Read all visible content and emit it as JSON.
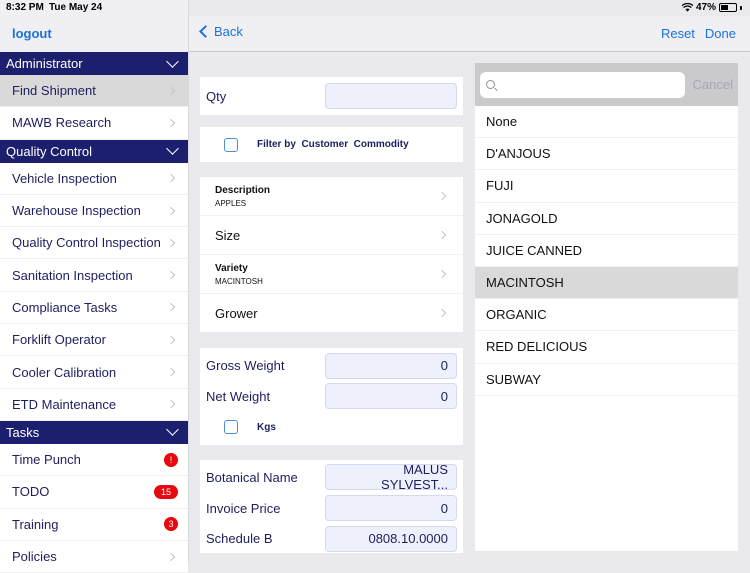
{
  "status_bar": {
    "time": "8:32 PM",
    "date": "Tue May 24",
    "battery_percent": "47%",
    "battery_level": 0.47
  },
  "sidebar": {
    "logout_label": "logout",
    "sections": [
      {
        "title": "Administrator",
        "items": [
          {
            "label": "Find Shipment",
            "selected": true
          },
          {
            "label": "MAWB Research"
          }
        ]
      },
      {
        "title": "Quality Control",
        "items": [
          {
            "label": "Vehicle Inspection"
          },
          {
            "label": "Warehouse Inspection"
          },
          {
            "label": "Quality Control Inspection"
          },
          {
            "label": "Sanitation Inspection"
          },
          {
            "label": "Compliance Tasks"
          },
          {
            "label": "Forklift Operator"
          },
          {
            "label": "Cooler Calibration"
          },
          {
            "label": "ETD Maintenance"
          }
        ]
      },
      {
        "title": "Tasks",
        "items": [
          {
            "label": "Time Punch",
            "badge": "!"
          },
          {
            "label": "TODO",
            "badge": "15"
          },
          {
            "label": "Training",
            "badge": "3"
          },
          {
            "label": "Policies"
          }
        ]
      }
    ]
  },
  "navbar": {
    "back_label": "Back",
    "reset_label": "Reset",
    "done_label": "Done"
  },
  "form": {
    "qty": {
      "label": "Qty",
      "value": ""
    },
    "filter": {
      "label": "Filter by  Customer  Commodity",
      "checked": false
    },
    "description": {
      "label": "Description",
      "value": "APPLES"
    },
    "size": {
      "label": "Size"
    },
    "variety": {
      "label": "Variety",
      "value": "MACINTOSH"
    },
    "grower": {
      "label": "Grower"
    },
    "gross_weight": {
      "label": "Gross Weight",
      "value": "0"
    },
    "net_weight": {
      "label": "Net Weight",
      "value": "0"
    },
    "kgs": {
      "label": "Kgs",
      "checked": false
    },
    "botanical_name": {
      "label": "Botanical Name",
      "value": "MALUS SYLVEST..."
    },
    "invoice_price": {
      "label": "Invoice Price",
      "value": "0"
    },
    "schedule_b": {
      "label": "Schedule B",
      "value": "0808.10.0000"
    }
  },
  "picker": {
    "search_placeholder": "",
    "cancel_label": "Cancel",
    "options": [
      "None",
      "D'ANJOUS",
      "FUJI",
      "JONAGOLD",
      "JUICE CANNED",
      "MACINTOSH",
      "ORGANIC",
      "RED DELICIOUS",
      "SUBWAY"
    ],
    "selected": "MACINTOSH"
  },
  "colors": {
    "accent": "#1a73d9",
    "section_header": "#1c1f6e",
    "badge": "#e8080f",
    "selected_row": "#d9d9d9"
  }
}
